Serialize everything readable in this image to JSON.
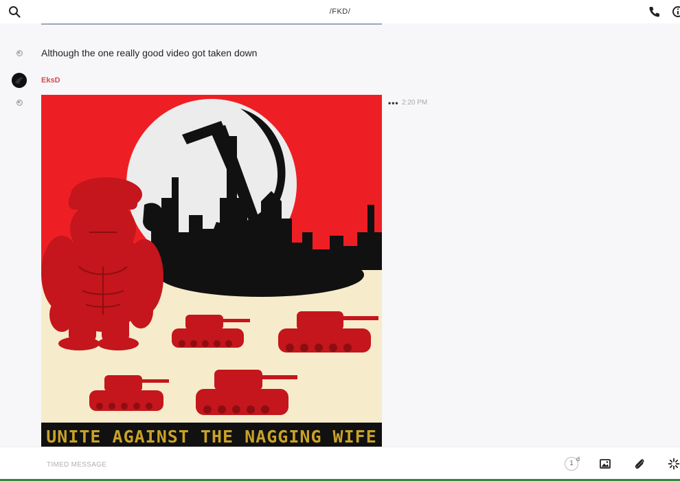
{
  "header": {
    "title": "/FKD/",
    "icons": [
      "search-icon",
      "phone-icon",
      "info-icon"
    ]
  },
  "messages": [
    {
      "text": "Although the one really good video got taken down"
    },
    {
      "sender": "EksD",
      "time": "2:20 PM",
      "menu_label": "•••",
      "poster_caption": "UNITE AGAINST THE NAGGING WIFE"
    }
  ],
  "composer": {
    "placeholder": "TIMED MESSAGE",
    "timer_value": "1",
    "timer_unit": "d",
    "icons": [
      "timer-icon",
      "image-icon",
      "paperclip-icon",
      "sparkle-icon"
    ]
  },
  "colors": {
    "sender": "#d64c4c",
    "poster_red": "#ee1f24",
    "poster_cream": "#f6eccb",
    "caption_gold": "#c9a227",
    "accent_line": "#2e8b3a"
  }
}
